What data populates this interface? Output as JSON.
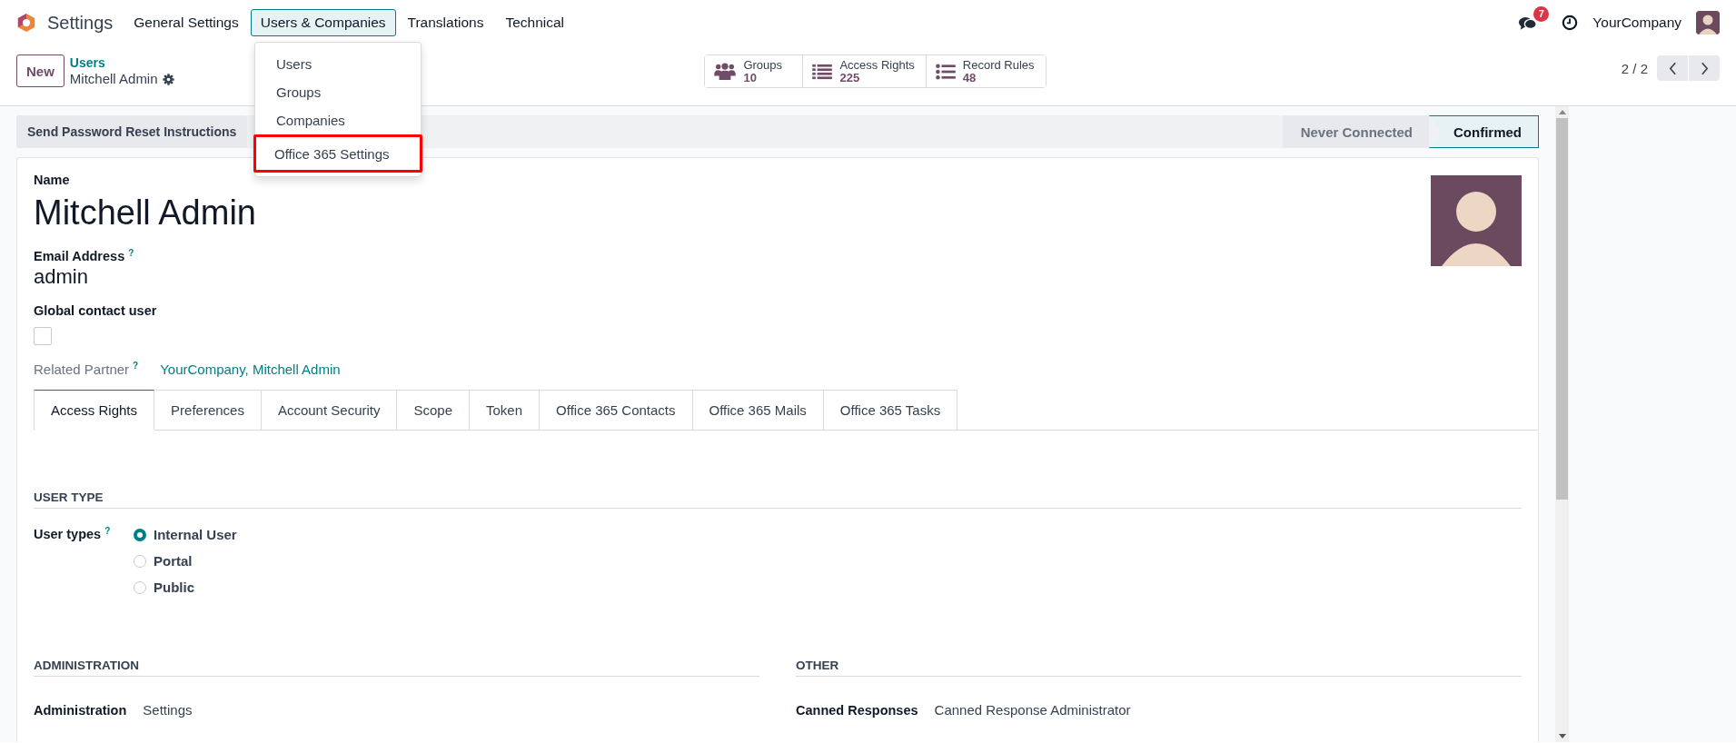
{
  "app": {
    "title": "Settings"
  },
  "menu": [
    {
      "label": "General Settings",
      "selected": false
    },
    {
      "label": "Users & Companies",
      "selected": true
    },
    {
      "label": "Translations",
      "selected": false
    },
    {
      "label": "Technical",
      "selected": false
    }
  ],
  "dropdown": [
    {
      "label": "Users",
      "highlighted": false
    },
    {
      "label": "Groups",
      "highlighted": false
    },
    {
      "label": "Companies",
      "highlighted": false
    },
    {
      "label": "Office 365 Settings",
      "highlighted": true
    }
  ],
  "systray": {
    "messages_badge": "7",
    "company": "YourCompany"
  },
  "control_panel": {
    "new_button": "New",
    "breadcrumb": "Users",
    "record": "Mitchell Admin",
    "pager": "2 / 2"
  },
  "smart_buttons": [
    {
      "kind": "groups",
      "label": "Groups",
      "value": "10"
    },
    {
      "kind": "list",
      "label": "Access Rights",
      "value": "225"
    },
    {
      "kind": "rules",
      "label": "Record Rules",
      "value": "48"
    }
  ],
  "action_button": "Send Password Reset Instructions",
  "statusbar": [
    {
      "label": "Never Connected",
      "selected": false
    },
    {
      "label": "Confirmed",
      "selected": true
    }
  ],
  "form": {
    "name_label": "Name",
    "name": "Mitchell Admin",
    "email_label": "Email Address",
    "email_help": "?",
    "email": "admin",
    "global_label": "Global contact user",
    "global_checked": false,
    "partner_label": "Related Partner",
    "partner_help": "?",
    "partner": "YourCompany, Mitchell Admin"
  },
  "tabs": [
    {
      "label": "Access Rights",
      "selected": true
    },
    {
      "label": "Preferences",
      "selected": false
    },
    {
      "label": "Account Security",
      "selected": false
    },
    {
      "label": "Scope",
      "selected": false
    },
    {
      "label": "Token",
      "selected": false
    },
    {
      "label": "Office 365 Contacts",
      "selected": false
    },
    {
      "label": "Office 365 Mails",
      "selected": false
    },
    {
      "label": "Office 365 Tasks",
      "selected": false
    }
  ],
  "user_type": {
    "heading": "USER TYPE",
    "label": "User types",
    "help": "?",
    "options": [
      {
        "label": "Internal User",
        "selected": true
      },
      {
        "label": "Portal",
        "selected": false
      },
      {
        "label": "Public",
        "selected": false
      }
    ]
  },
  "sections": [
    {
      "heading": "ADMINISTRATION",
      "rows": [
        {
          "label": "Administration",
          "value": "Settings"
        }
      ]
    },
    {
      "heading": "OTHER",
      "rows": [
        {
          "label": "Canned Responses",
          "value": "Canned Response Administrator"
        }
      ]
    }
  ]
}
